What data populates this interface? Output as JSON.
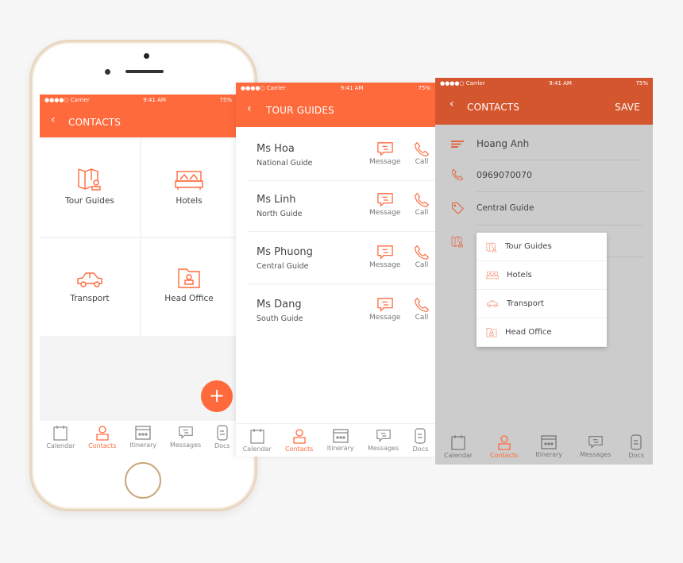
{
  "colors": {
    "accent": "#ff6a3d",
    "overlay_header": "#d4562f",
    "overlay_body": "#cccccc"
  },
  "status": {
    "carrier": "●●●●○ Carrier",
    "time": "9:41 AM",
    "battery": "75%"
  },
  "screen1": {
    "title": "CONTACTS",
    "back_icon": "chevron-left-icon",
    "categories": [
      {
        "label": "Tour Guides",
        "icon": "map-person-icon"
      },
      {
        "label": "Hotels",
        "icon": "bed-icon"
      },
      {
        "label": "Transport",
        "icon": "car-icon"
      },
      {
        "label": "Head Office",
        "icon": "folder-lock-icon"
      }
    ],
    "fab": "+"
  },
  "screen2": {
    "title": "TOUR GUIDES",
    "guides": [
      {
        "name": "Ms Hoa",
        "role": "National Guide"
      },
      {
        "name": "Ms Linh",
        "role": "North Guide"
      },
      {
        "name": "Ms Phuong",
        "role": "Central Guide"
      },
      {
        "name": "Ms Dang",
        "role": "South Guide"
      }
    ],
    "message_label": "Message",
    "call_label": "Call"
  },
  "screen3": {
    "title": "CONTACTS",
    "save": "SAVE",
    "name": "Hoang Anh",
    "phone": "0969070070",
    "role": "Central Guide",
    "dropdown": [
      "Tour Guides",
      "Hotels",
      "Transport",
      "Head Office"
    ]
  },
  "tabs": [
    {
      "label": "Calendar",
      "icon": "calendar-icon"
    },
    {
      "label": "Contacts",
      "icon": "person-icon",
      "active": true
    },
    {
      "label": "Itinerary",
      "icon": "itinerary-icon"
    },
    {
      "label": "Messages",
      "icon": "message-icon"
    },
    {
      "label": "Docs",
      "icon": "document-icon"
    }
  ],
  "calendar_day": "10"
}
